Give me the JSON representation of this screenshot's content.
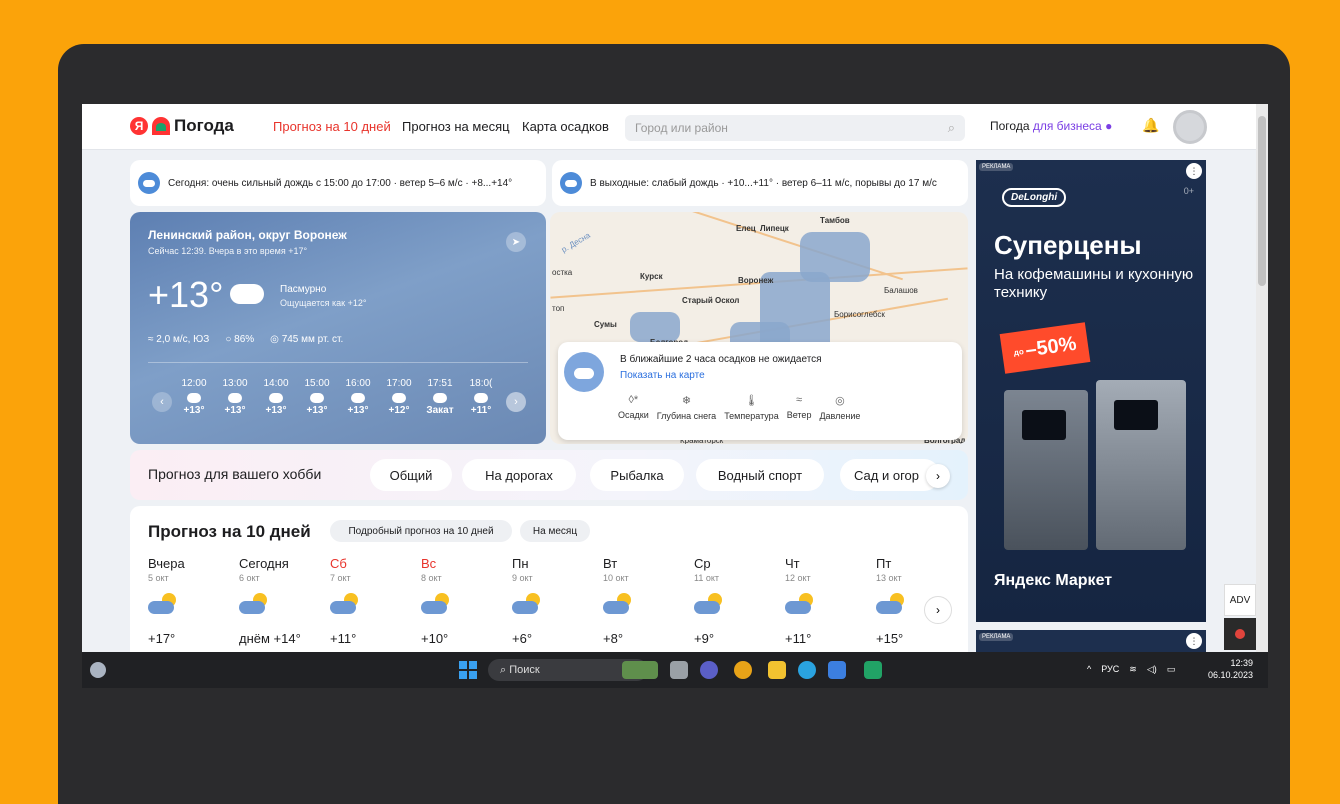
{
  "header": {
    "logo": "Погода",
    "nav": [
      "Прогноз на 10 дней",
      "Прогноз на месяц",
      "Карта осадков"
    ],
    "search_placeholder": "Город или район",
    "business": "Погода ",
    "business_accent": "для бизнеса"
  },
  "alerts": {
    "today": "Сегодня: очень сильный дождь с 15:00 до 17:00 · ветер 5–6 м/с · +8...+14°",
    "weekend": "В выходные: слабый дождь · +10...+11° · ветер 6–11 м/с, порывы до 17 м/с"
  },
  "now": {
    "location": "Ленинский район, округ Воронеж",
    "subtitle": "Сейчас 12:39. Вчера в это время +17°",
    "temp": "+13°",
    "condition": "Пасмурно",
    "feels": "Ощущается как +12°",
    "wind": "2,0 м/с, ЮЗ",
    "humidity": "86%",
    "pressure": "745 мм рт. ст.",
    "hours": [
      {
        "time": "12:00",
        "temp": "+13°"
      },
      {
        "time": "13:00",
        "temp": "+13°"
      },
      {
        "time": "14:00",
        "temp": "+13°"
      },
      {
        "time": "15:00",
        "temp": "+13°"
      },
      {
        "time": "16:00",
        "temp": "+13°"
      },
      {
        "time": "17:00",
        "temp": "+12°"
      },
      {
        "time": "17:51",
        "temp": "Закат"
      },
      {
        "time": "18:0(",
        "temp": "+11°"
      }
    ]
  },
  "map": {
    "cities": [
      "Елец",
      "Липецк",
      "Тамбов",
      "Курск",
      "Воронеж",
      "Старый Оскол",
      "Балашов",
      "Борисоглебск",
      "Сумы",
      "Белгород",
      "Краматорск",
      "Волгоград",
      "р. Десна",
      "остка",
      "топ"
    ],
    "popup_title": "В ближайшие 2 часа осадков не ожидается",
    "popup_link": "Показать на карте",
    "layers": [
      "Осадки",
      "Глубина снега",
      "Температура",
      "Ветер",
      "Давление"
    ]
  },
  "hobby": {
    "title": "Прогноз для вашего хобби",
    "chips": [
      "Общий",
      "На дорогах",
      "Рыбалка",
      "Водный спорт",
      "Сад и огор"
    ]
  },
  "forecast": {
    "title": "Прогноз на 10 дней",
    "detail_pill": "Подробный прогноз на 10 дней",
    "month_pill": "На месяц",
    "days": [
      {
        "name": "Вчера",
        "date": "5 окт",
        "temp": "+17°",
        "weekend": false
      },
      {
        "name": "Сегодня",
        "date": "6 окт",
        "temp": "днём +14°",
        "weekend": false
      },
      {
        "name": "Сб",
        "date": "7 окт",
        "temp": "+11°",
        "weekend": true
      },
      {
        "name": "Вс",
        "date": "8 окт",
        "temp": "+10°",
        "weekend": true
      },
      {
        "name": "Пн",
        "date": "9 окт",
        "temp": "+6°",
        "weekend": false
      },
      {
        "name": "Вт",
        "date": "10 окт",
        "temp": "+8°",
        "weekend": false
      },
      {
        "name": "Ср",
        "date": "11 окт",
        "temp": "+9°",
        "weekend": false
      },
      {
        "name": "Чт",
        "date": "12 окт",
        "temp": "+11°",
        "weekend": false
      },
      {
        "name": "Пт",
        "date": "13 окт",
        "temp": "+15°",
        "weekend": false
      }
    ]
  },
  "ad": {
    "tag": "РЕКЛАМА",
    "brand": "DeLonghi",
    "age": "0+",
    "headline": "Суперцены",
    "subline": "На кофемашины и кухонную технику",
    "sale_prefix": "до",
    "sale": "–50%",
    "market": "Яндекс Маркет",
    "adv": "ADV"
  },
  "taskbar": {
    "search": "Поиск",
    "lang": "РУС",
    "time": "12:39",
    "date": "06.10.2023"
  },
  "colors": {
    "accent": "#e8342c",
    "link": "#2b6fde",
    "purple": "#7b3fe4"
  }
}
